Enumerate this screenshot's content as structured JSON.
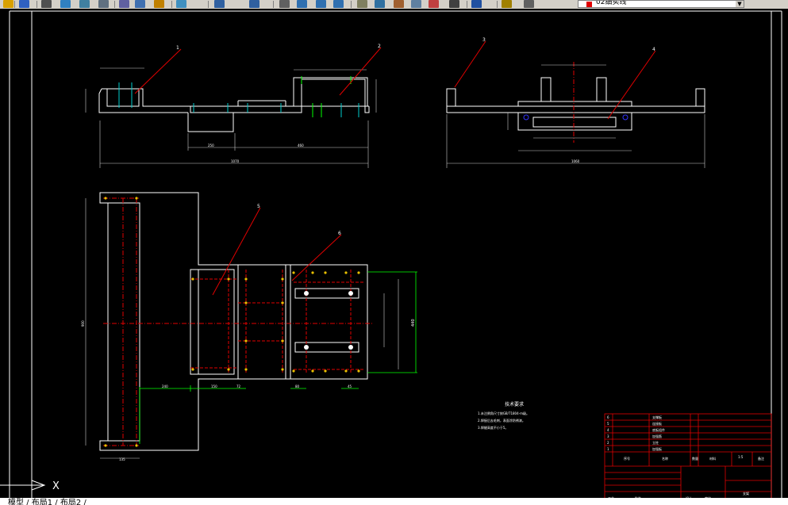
{
  "toolbar": {
    "buttons": [
      "open-icon",
      "save-icon",
      "print-icon",
      "preview-icon",
      "publish-icon",
      "plot-icon",
      "cut-icon",
      "copy-icon",
      "paste-icon",
      "match-icon",
      "undo-icon",
      "redo-icon",
      "pan-icon",
      "zoom-realtime-icon",
      "zoom-window-icon",
      "zoom-previous-icon",
      "properties-icon",
      "designcenter-icon",
      "toolpalette-icon",
      "sheetset-icon",
      "markup-icon",
      "calculator-icon",
      "help-icon",
      "layer-manager-icon",
      "layer-state-icon"
    ],
    "layer_current": "02细实线"
  },
  "drawing": {
    "balloons": [
      "1",
      "2",
      "3",
      "4",
      "5",
      "6"
    ],
    "tech_title": "技术要求",
    "tech_lines": [
      "1.未注倒角尺寸按GB/T1804-m级。",
      "2.焊接后去毛刺，表面涂防锈漆。",
      "3.焊缝高度不小于5。"
    ],
    "dims": {
      "front_total": "1070",
      "front_a": "250",
      "front_b": "460",
      "side_total": "1060",
      "plan_total": "900",
      "plan_left": "240",
      "plan_c": "150",
      "plan_d": "72",
      "plan_e": "80",
      "plan_f": "45",
      "plan_height": "440",
      "plan_bottom": "135"
    }
  },
  "title_block": {
    "row_labels": [
      "支撑板",
      "连接板",
      "底板组件",
      "加强筋",
      "立柱",
      "加强板"
    ],
    "row_nums": [
      "6",
      "5",
      "4",
      "3",
      "2",
      "1"
    ],
    "head": [
      "序号",
      "名称",
      "数量",
      "材料",
      "备注"
    ],
    "scale": "1:5",
    "drawing_name": "支架",
    "sign": [
      "设计",
      "审核",
      "工艺",
      "批准"
    ]
  },
  "ucs": {
    "x_label": "X"
  },
  "command": {
    "text": "模型 / 布局1 / 布局2 /"
  }
}
